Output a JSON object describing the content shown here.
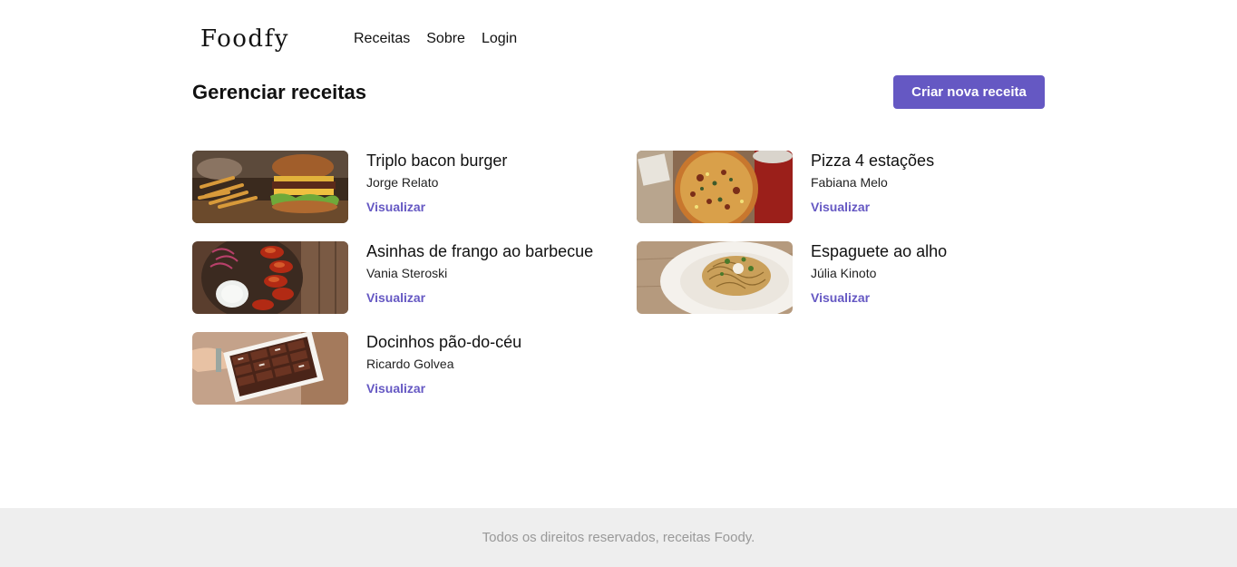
{
  "header": {
    "logo": "Foodfy",
    "nav": [
      {
        "label": "Receitas"
      },
      {
        "label": "Sobre"
      },
      {
        "label": "Login"
      }
    ]
  },
  "main": {
    "title": "Gerenciar receitas",
    "create_button": "Criar nova receita",
    "recipes": [
      {
        "title": "Triplo bacon burger",
        "author": "Jorge Relato",
        "link": "Visualizar",
        "image": "burger-photo"
      },
      {
        "title": "Pizza 4 estações",
        "author": "Fabiana Melo",
        "link": "Visualizar",
        "image": "pizza-photo"
      },
      {
        "title": "Asinhas de frango ao barbecue",
        "author": "Vania Steroski",
        "link": "Visualizar",
        "image": "chicken-wings-photo"
      },
      {
        "title": "Espaguete ao alho",
        "author": "Júlia Kinoto",
        "link": "Visualizar",
        "image": "spaghetti-photo"
      },
      {
        "title": "Docinhos pão-do-céu",
        "author": "Ricardo Golvea",
        "link": "Visualizar",
        "image": "sweets-photo"
      }
    ]
  },
  "footer": {
    "text": "Todos os direitos reservados, receitas Foody."
  },
  "colors": {
    "accent": "#6558c3",
    "footer_bg": "#eeeeee",
    "footer_text": "#999999"
  }
}
